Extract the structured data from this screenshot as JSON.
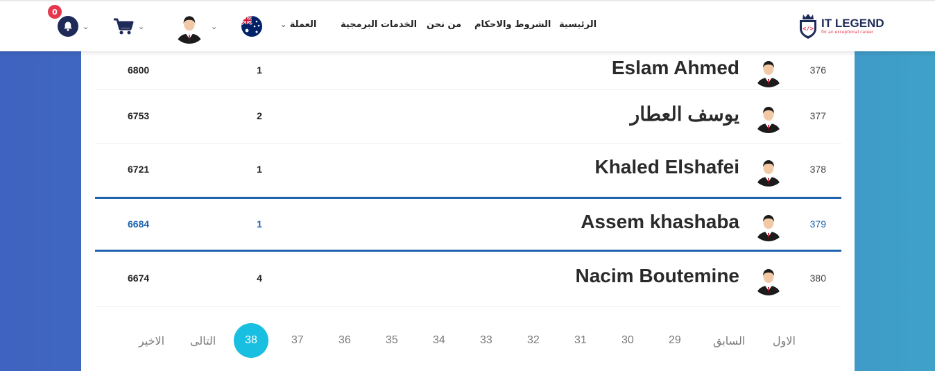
{
  "header": {
    "notifications_count": "0",
    "nav": {
      "home": "الرئيسية",
      "terms": "الشروط والاحكام",
      "about": "من نحن",
      "services": "الخدمات البرمجية",
      "currency": "العملة"
    },
    "logo": {
      "title": "IT LEGEND",
      "subtitle": "for an exceptional career"
    },
    "icons": {
      "bell": "bell-icon",
      "cart": "cart-icon",
      "chevron": "chevron-down-icon",
      "flag": "australia-flag-icon"
    }
  },
  "leaderboard": {
    "rows": [
      {
        "rank": "376",
        "name": "Eslam Ahmed",
        "count": "1",
        "score": "6800",
        "highlighted": false
      },
      {
        "rank": "377",
        "name": "يوسف العطار",
        "count": "2",
        "score": "6753",
        "highlighted": false
      },
      {
        "rank": "378",
        "name": "Khaled Elshafei",
        "count": "1",
        "score": "6721",
        "highlighted": false
      },
      {
        "rank": "379",
        "name": "Assem khashaba",
        "count": "1",
        "score": "6684",
        "highlighted": true
      },
      {
        "rank": "380",
        "name": "Nacim Boutemine",
        "count": "4",
        "score": "6674",
        "highlighted": false
      }
    ]
  },
  "pagination": {
    "first": "الاول",
    "prev": "السابق",
    "pages": [
      "29",
      "30",
      "31",
      "32",
      "33",
      "34",
      "35",
      "36",
      "37"
    ],
    "current": "38",
    "next": "التالى",
    "last": "الاخير"
  },
  "colors": {
    "accent": "#1e63b0",
    "active_page": "#18bfe0",
    "badge": "#e5384e",
    "brand": "#1e2a57"
  }
}
